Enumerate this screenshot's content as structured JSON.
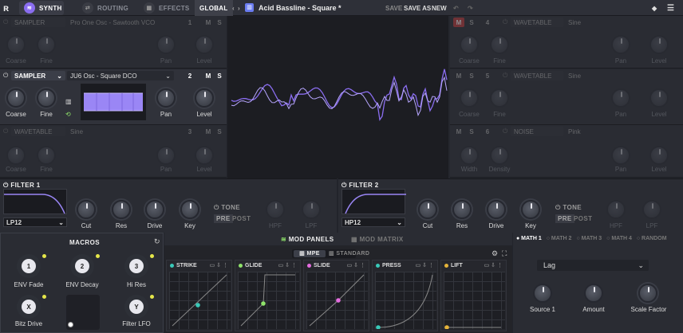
{
  "colors": {
    "accent": "#8a6df0",
    "teal": "#39c9b8",
    "green": "#8fe36a",
    "pink": "#e66de0",
    "yellow": "#e5b43a",
    "red": "#c53a3a"
  },
  "topbar": {
    "tabs": [
      {
        "label": "SYNTH",
        "icon": "synth-icon"
      },
      {
        "label": "ROUTING",
        "icon": "routing-icon"
      },
      {
        "label": "EFFECTS",
        "icon": "effects-icon"
      },
      {
        "label": "GLOBAL",
        "icon": ""
      }
    ],
    "nav_prev": "‹",
    "nav_next": "›",
    "preset_name": "Acid Bassline - Square *",
    "save": "SAVE",
    "save_as": "SAVE AS",
    "new": "NEW"
  },
  "osc_left": [
    {
      "type": "SAMPLER",
      "source": "Pro One Osc - Sawtooth VCO",
      "num": "1",
      "m": "M",
      "s": "S",
      "knobs": [
        "Coarse",
        "Fine",
        "Pan",
        "Level"
      ]
    },
    {
      "type": "SAMPLER",
      "source": "JU6 Osc - Square DCO",
      "num": "2",
      "m": "M",
      "s": "S",
      "knobs": [
        "Coarse",
        "Fine",
        "Pan",
        "Level"
      ]
    },
    {
      "type": "WAVETABLE",
      "source": "Sine",
      "num": "3",
      "m": "M",
      "s": "S",
      "knobs": [
        "Coarse",
        "Fine",
        "Pan",
        "Level"
      ]
    }
  ],
  "osc_right": [
    {
      "type": "WAVETABLE",
      "source": "Sine",
      "num": "4",
      "m": "M",
      "s": "S",
      "knobs": [
        "Coarse",
        "Fine",
        "Pan",
        "Level"
      ]
    },
    {
      "type": "WAVETABLE",
      "source": "Sine",
      "num": "5",
      "m": "M",
      "s": "S",
      "knobs": [
        "Coarse",
        "Fine",
        "Pan",
        "Level"
      ]
    },
    {
      "type": "NOISE",
      "source": "Pink",
      "num": "6",
      "m": "M",
      "s": "S",
      "knobs": [
        "Width",
        "Density",
        "Pan",
        "Level"
      ]
    }
  ],
  "filters": [
    {
      "title": "FILTER 1",
      "type": "LP12",
      "knobs": [
        "Cut",
        "Res",
        "Drive",
        "Key"
      ],
      "tone": "TONE",
      "pre": "PRE",
      "post": "POST",
      "hpf": "HPF",
      "lpf": "LPF"
    },
    {
      "title": "FILTER 2",
      "type": "HP12",
      "knobs": [
        "Cut",
        "Res",
        "Drive",
        "Key"
      ],
      "tone": "TONE",
      "pre": "PRE",
      "post": "POST",
      "hpf": "HPF",
      "lpf": "LPF"
    }
  ],
  "macros": {
    "title": "MACROS",
    "items": [
      {
        "badge": "1",
        "label": "ENV Fade"
      },
      {
        "badge": "2",
        "label": "ENV Decay"
      },
      {
        "badge": "3",
        "label": "Hi Res"
      },
      {
        "badge": "X",
        "label": "Bitz Drive"
      },
      {
        "badge": "Y",
        "label": "Filter LFO"
      }
    ]
  },
  "modpanels": {
    "tab1": "MOD PANELS",
    "tab2": "MOD MATRIX",
    "mode1": "MPE",
    "mode2": "STANDARD",
    "panels": [
      {
        "title": "STRIKE",
        "color": "#39c9b8"
      },
      {
        "title": "GLIDE",
        "color": "#8fe36a"
      },
      {
        "title": "SLIDE",
        "color": "#e66de0"
      },
      {
        "title": "PRESS",
        "color": "#39c9b8"
      },
      {
        "title": "LIFT",
        "color": "#e5b43a"
      }
    ]
  },
  "math": {
    "tabs": [
      "MATH 1",
      "MATH 2",
      "MATH 3",
      "MATH 4",
      "RANDOM"
    ],
    "mode": "Lag",
    "knobs": [
      "Source 1",
      "Amount",
      "Scale Factor"
    ]
  }
}
